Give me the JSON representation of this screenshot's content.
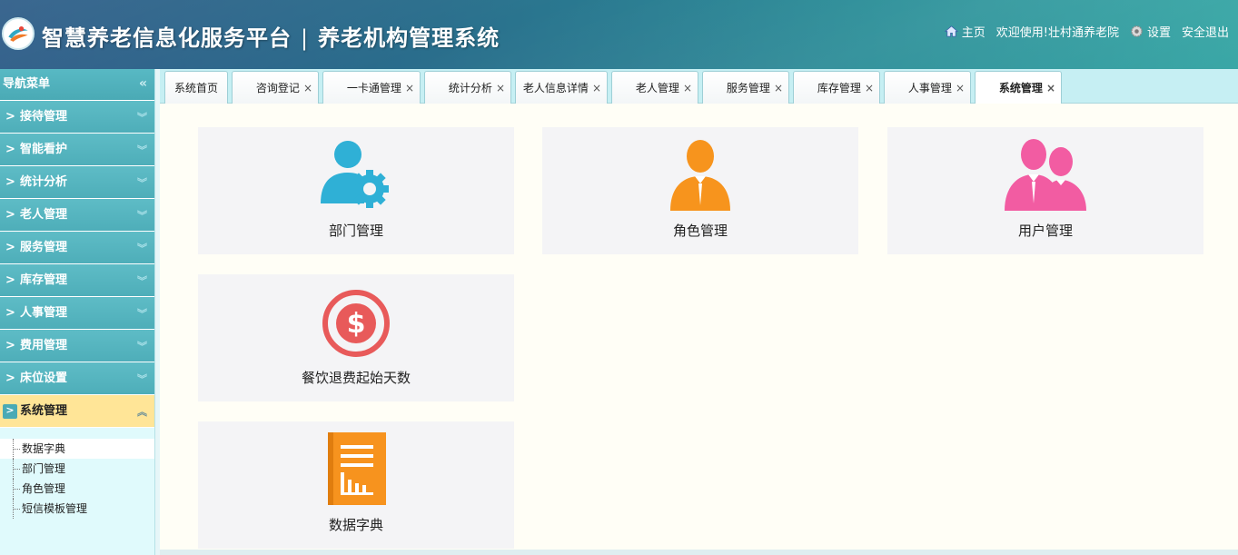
{
  "header": {
    "title_main": "智慧养老信息化服务平台",
    "title_sep": "|",
    "title_sub": "养老机构管理系统",
    "home_label": "主页",
    "welcome": "欢迎使用!壮村通养老院",
    "settings_label": "设置",
    "logout_label": "安全退出"
  },
  "sidebar": {
    "title": "导航菜单",
    "collapse_glyph": "«",
    "items": [
      {
        "label": "接待管理"
      },
      {
        "label": "智能看护"
      },
      {
        "label": "统计分析"
      },
      {
        "label": "老人管理"
      },
      {
        "label": "服务管理"
      },
      {
        "label": "库存管理"
      },
      {
        "label": "人事管理"
      },
      {
        "label": "费用管理"
      },
      {
        "label": "床位设置"
      },
      {
        "label": "系统管理"
      }
    ],
    "sub_items": [
      {
        "label": "数据字典"
      },
      {
        "label": "部门管理"
      },
      {
        "label": "角色管理"
      },
      {
        "label": "短信模板管理"
      }
    ]
  },
  "tabs": [
    {
      "label": "系统首页"
    },
    {
      "label": "咨询登记"
    },
    {
      "label": "一卡通管理"
    },
    {
      "label": "统计分析"
    },
    {
      "label": "老人信息详情"
    },
    {
      "label": "老人管理"
    },
    {
      "label": "服务管理"
    },
    {
      "label": "库存管理"
    },
    {
      "label": "人事管理"
    },
    {
      "label": "系统管理"
    }
  ],
  "tab_close_glyph": "×",
  "cards": [
    {
      "label": "部门管理",
      "icon": "department-settings-icon",
      "color": "#2fb0d6"
    },
    {
      "label": "角色管理",
      "icon": "role-person-icon",
      "color": "#f7941d"
    },
    {
      "label": "用户管理",
      "icon": "users-group-icon",
      "color": "#f25ca2"
    },
    {
      "label": "餐饮退费起始天数",
      "icon": "dollar-coin-icon",
      "color": "#e85a5a"
    },
    {
      "label": "数据字典",
      "icon": "dictionary-book-icon",
      "color": "#f7931e"
    }
  ]
}
